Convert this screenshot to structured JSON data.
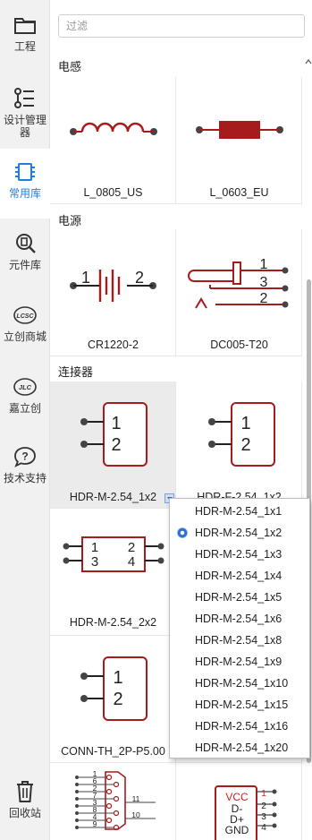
{
  "nav": {
    "items": [
      {
        "label": "工程",
        "icon": "folder-icon"
      },
      {
        "label": "设计管理器",
        "icon": "design-manager-icon"
      },
      {
        "label": "常用库",
        "icon": "chip-icon"
      },
      {
        "label": "元件库",
        "icon": "component-search-icon"
      },
      {
        "label": "立创商城",
        "icon": "lcsc-icon"
      },
      {
        "label": "嘉立创",
        "icon": "jlc-icon"
      },
      {
        "label": "技术支持",
        "icon": "help-icon"
      },
      {
        "label": "回收站",
        "icon": "trash-icon"
      }
    ],
    "design_manager_line1": "设计管理",
    "design_manager_line2": "器",
    "active": "常用库"
  },
  "search": {
    "placeholder": "过滤",
    "value": ""
  },
  "sections": {
    "inductor": {
      "title": "电感",
      "items": [
        {
          "name": "L_0805_US"
        },
        {
          "name": "L_0603_EU"
        }
      ]
    },
    "power": {
      "title": "电源",
      "items": [
        {
          "name": "CR1220-2",
          "pins": [
            "1",
            "2"
          ]
        },
        {
          "name": "DC005-T20",
          "pins": [
            "1",
            "3",
            "2"
          ]
        }
      ]
    },
    "connector": {
      "title": "连接器",
      "items": [
        {
          "name": "HDR-M-2.54_1x2",
          "pins": [
            "1",
            "2"
          ]
        },
        {
          "name": "HDR-F-2.54_1x2",
          "pins": [
            "1",
            "2"
          ]
        },
        {
          "name": "HDR-M-2.54_2x2",
          "pins": [
            "1",
            "2",
            "3",
            "4"
          ]
        },
        {
          "name": "CONN-TH_2P-P5.00",
          "pins": [
            "1",
            "2"
          ]
        }
      ]
    },
    "bottom": {
      "dsub_pins": [
        "1",
        "6",
        "2",
        "7",
        "3",
        "8",
        "4",
        "9"
      ],
      "dsub_side": [
        "11",
        "10"
      ],
      "usb_labels": [
        "VCC",
        "D-",
        "D+",
        "GND"
      ],
      "usb_pins": [
        "1",
        "2",
        "3",
        "4"
      ]
    }
  },
  "dropdown": {
    "selected": "HDR-M-2.54_1x2",
    "options": [
      "HDR-M-2.54_1x1",
      "HDR-M-2.54_1x2",
      "HDR-M-2.54_1x3",
      "HDR-M-2.54_1x4",
      "HDR-M-2.54_1x5",
      "HDR-M-2.54_1x6",
      "HDR-M-2.54_1x8",
      "HDR-M-2.54_1x9",
      "HDR-M-2.54_1x10",
      "HDR-M-2.54_1x15",
      "HDR-M-2.54_1x16",
      "HDR-M-2.54_1x20"
    ]
  },
  "colors": {
    "symbol": "#a61c1c",
    "pin": "#444444",
    "accent": "#1e7ee0"
  }
}
